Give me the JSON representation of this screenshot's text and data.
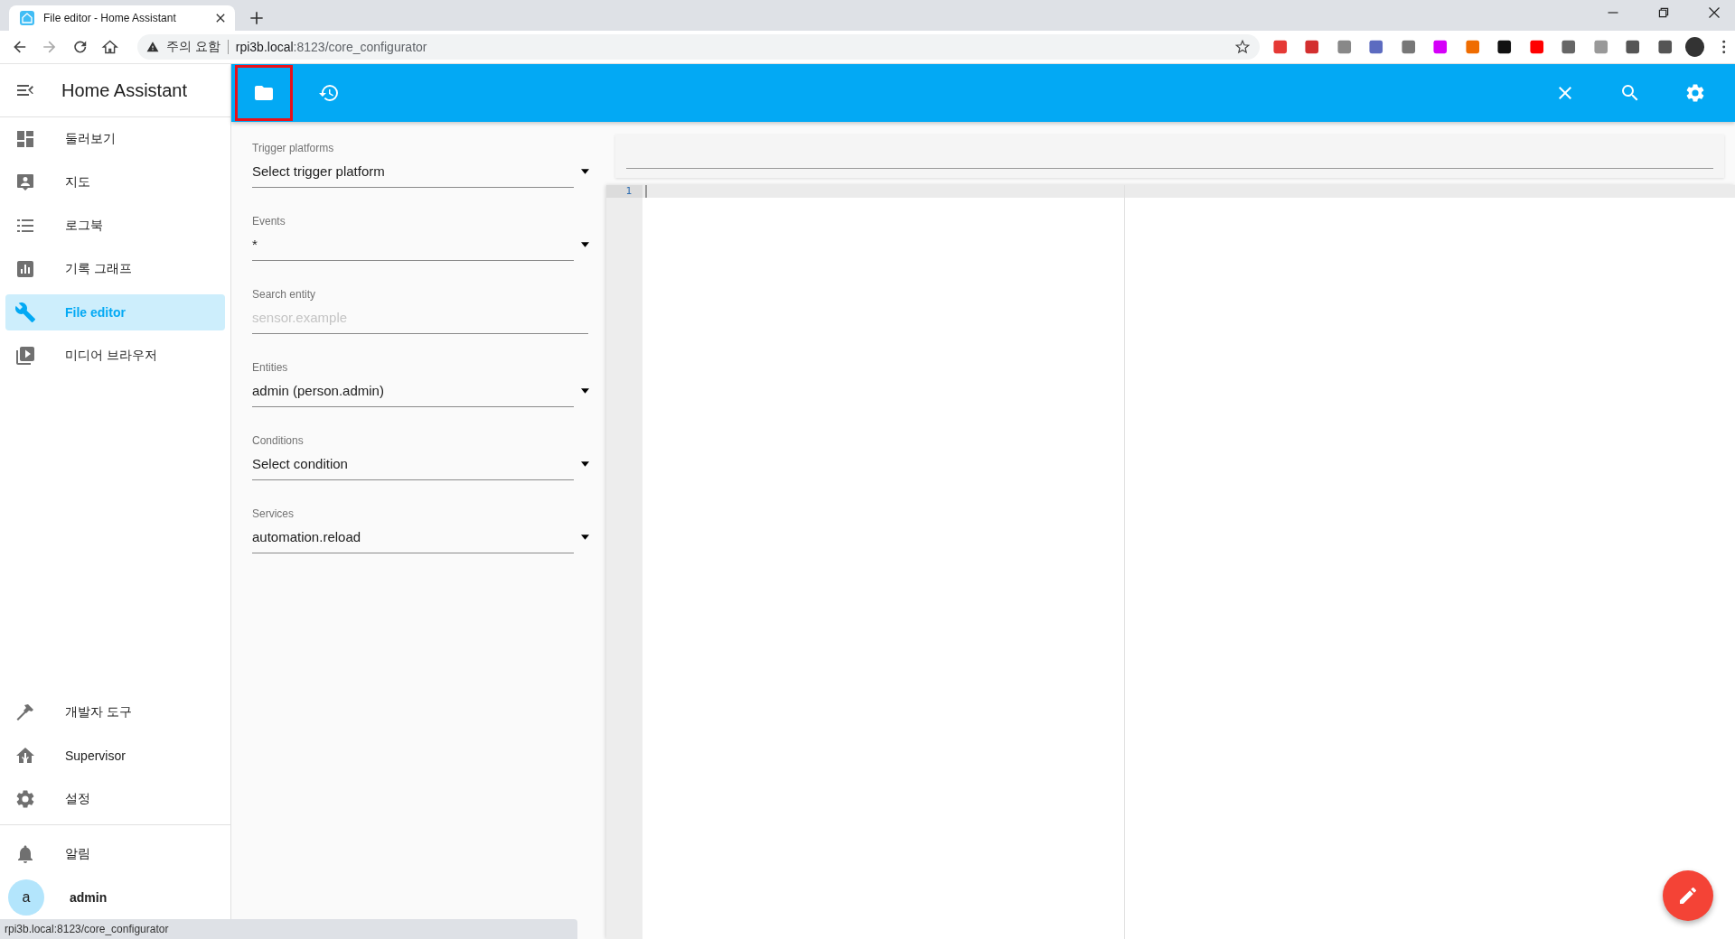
{
  "browser": {
    "tab": {
      "title": "File editor - Home Assistant"
    },
    "address": {
      "security": "주의 요함",
      "host": "rpi3b.local",
      "path": ":8123/core_configurator"
    }
  },
  "sidebar": {
    "title": "Home Assistant",
    "items": [
      {
        "label": "둘러보기",
        "selected": false
      },
      {
        "label": "지도",
        "selected": false
      },
      {
        "label": "로그북",
        "selected": false
      },
      {
        "label": "기록 그래프",
        "selected": false
      },
      {
        "label": "File editor",
        "selected": true
      },
      {
        "label": "미디어 브라우저",
        "selected": false
      }
    ],
    "bottom_items": [
      {
        "label": "개발자 도구"
      },
      {
        "label": "Supervisor"
      },
      {
        "label": "설정"
      }
    ],
    "notifications": {
      "label": "알림"
    },
    "user": {
      "initial": "a",
      "name": "admin"
    }
  },
  "toolbar": {
    "left": [
      {
        "kind": "folder",
        "highlighted": true
      },
      {
        "kind": "history",
        "highlighted": false
      }
    ],
    "right": [
      {
        "kind": "close"
      },
      {
        "kind": "search"
      },
      {
        "kind": "settings"
      }
    ]
  },
  "form": {
    "fields": [
      {
        "kind": "dropdown",
        "label": "Trigger platforms",
        "value": "Select trigger platform"
      },
      {
        "kind": "dropdown",
        "label": "Events",
        "value": "*"
      },
      {
        "kind": "text",
        "label": "Search entity",
        "placeholder": "sensor.example"
      },
      {
        "kind": "dropdown",
        "label": "Entities",
        "value": "admin (person.admin)"
      },
      {
        "kind": "dropdown",
        "label": "Conditions",
        "value": "Select condition"
      },
      {
        "kind": "dropdown",
        "label": "Services",
        "value": "automation.reload"
      }
    ]
  },
  "editor": {
    "line_numbers": [
      "1"
    ]
  },
  "status_bar": {
    "url": "rpi3b.local:8123/core_configurator"
  }
}
